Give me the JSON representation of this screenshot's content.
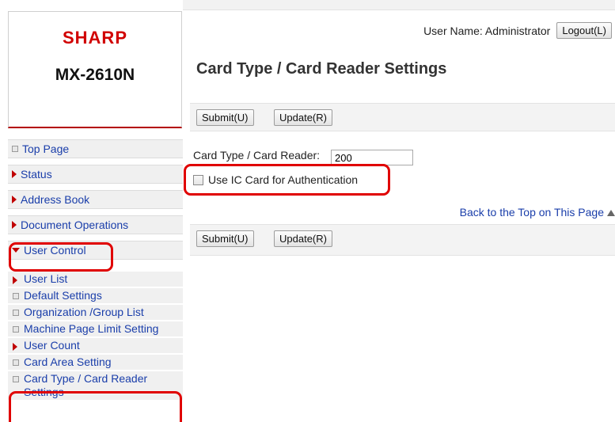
{
  "brand": {
    "logo": "SHARP",
    "model": "MX-2610N"
  },
  "header": {
    "user_name": "User Name: Administrator",
    "logout_label": "Logout(L)"
  },
  "main": {
    "title": "Card Type / Card Reader Settings",
    "submit_label": "Submit(U)",
    "update_label": "Update(R)",
    "card_type_label": "Card Type / Card Reader:",
    "card_type_value": "200",
    "use_ic_card_label": "Use IC Card for Authentication",
    "use_ic_card_checked": false,
    "back_to_top_label": "Back to the Top on This Page"
  },
  "nav": {
    "top_page": "Top Page",
    "status": "Status",
    "address_book": "Address Book",
    "document_operations": "Document Operations",
    "user_control": "User Control"
  },
  "subnav": {
    "user_list": "User List",
    "default_settings": "Default Settings",
    "organization_group_list": "Organization /Group List",
    "machine_page_limit": "Machine Page Limit Setting",
    "user_count": "User Count",
    "card_area_setting": "Card Area Setting",
    "card_type_reader_settings": "Card Type / Card Reader Settings"
  },
  "colors": {
    "highlight": "#e00000",
    "link": "#1a3eaa",
    "brand_red": "#d10000"
  },
  "icons": {
    "bullet": "square-bullet-icon",
    "collapsed": "triangle-right-icon",
    "expanded": "triangle-down-icon",
    "back_to_top": "triangle-up-icon"
  }
}
